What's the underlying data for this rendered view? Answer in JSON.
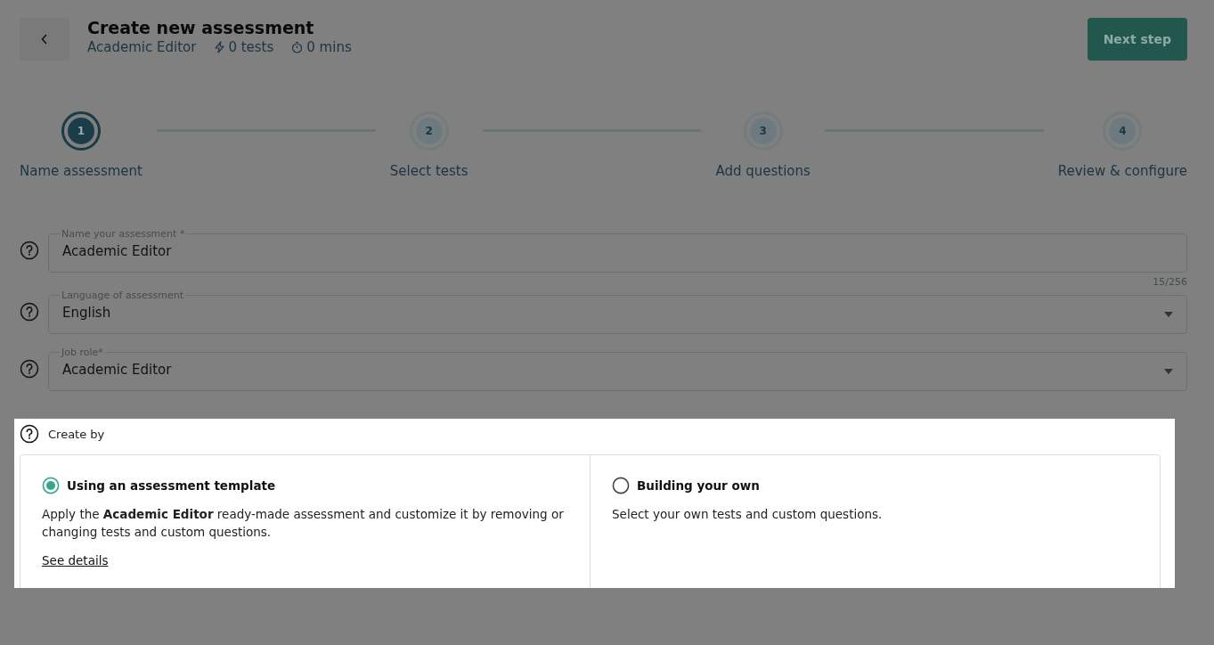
{
  "header": {
    "title": "Create new assessment",
    "subtitle": "Academic Editor",
    "tests": "0 tests",
    "duration": "0 mins",
    "next_button": "Next step"
  },
  "steps": [
    {
      "number": "1",
      "label": "Name assessment",
      "current": true
    },
    {
      "number": "2",
      "label": "Select tests",
      "current": false
    },
    {
      "number": "3",
      "label": "Add questions",
      "current": false
    },
    {
      "number": "4",
      "label": "Review & configure",
      "current": false
    }
  ],
  "fields": [
    {
      "kind": "text",
      "label": "Name your assessment *",
      "value": "Academic Editor",
      "counter": "15/256"
    },
    {
      "kind": "select",
      "label": "Language of assessment",
      "value": "English"
    },
    {
      "kind": "select",
      "label": "Job role*",
      "value": "Academic Editor"
    }
  ],
  "create_by": {
    "label": "Create by",
    "options": [
      {
        "title": "Using an assessment template",
        "description": "Apply the **Academic Editor** ready-made assessment and customize it by removing or changing tests and custom questions.",
        "link": "See details",
        "selected": true
      },
      {
        "title": "Building your own",
        "description": "Select your own tests and custom questions.",
        "selected": false
      }
    ]
  }
}
